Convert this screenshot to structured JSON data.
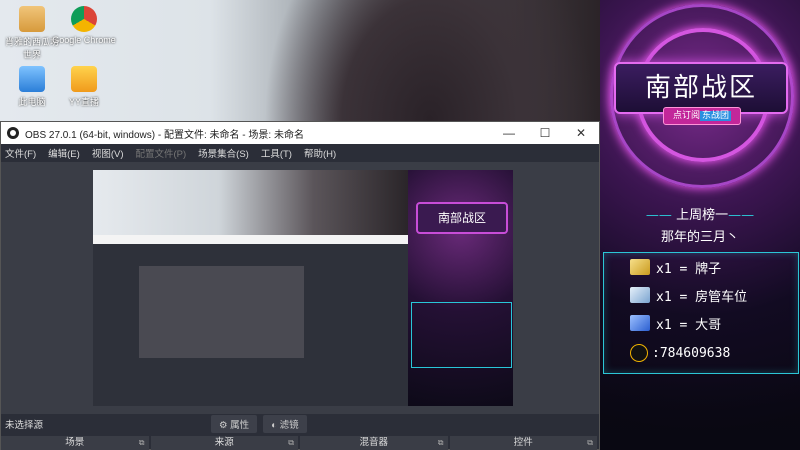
{
  "desktop": {
    "icons": [
      {
        "name": "user-folder-icon",
        "label": "肖雅的西瓜坊\n世界"
      },
      {
        "name": "chrome-icon",
        "label": "Google Chrome"
      },
      {
        "name": "computer-icon",
        "label": "此电脑"
      },
      {
        "name": "app-icon",
        "label": "YY直播"
      }
    ]
  },
  "obs": {
    "title": "OBS 27.0.1 (64-bit, windows) - 配置文件: 未命名 - 场景: 未命名",
    "menu": [
      "文件(F)",
      "编辑(E)",
      "视图(V)",
      "配置文件(P)",
      "场景集合(S)",
      "工具(T)",
      "帮助(H)"
    ],
    "status_no_source": "未选择源",
    "properties_label": "属性",
    "filters_label": "滤镜",
    "docks": [
      "场景",
      "来源",
      "混音器",
      "控件"
    ]
  },
  "poster": {
    "title": "南部战区",
    "subtitle_badge_pre": "点订阅",
    "subtitle_badge_hl": "东战团",
    "ranking_header": "上周榜一",
    "song_line": "那年的三月丶",
    "rank_rows": [
      {
        "icon": "golden-pen-icon",
        "text": "x1 = 牌子",
        "color": "#e8c34a"
      },
      {
        "icon": "car-icon",
        "text": "x1 = 房管车位",
        "color": "#b8d4f0"
      },
      {
        "icon": "rocket-icon",
        "text": "x1 = 大哥",
        "color": "#6fa3ff"
      }
    ],
    "qq_text": ":784609638"
  }
}
